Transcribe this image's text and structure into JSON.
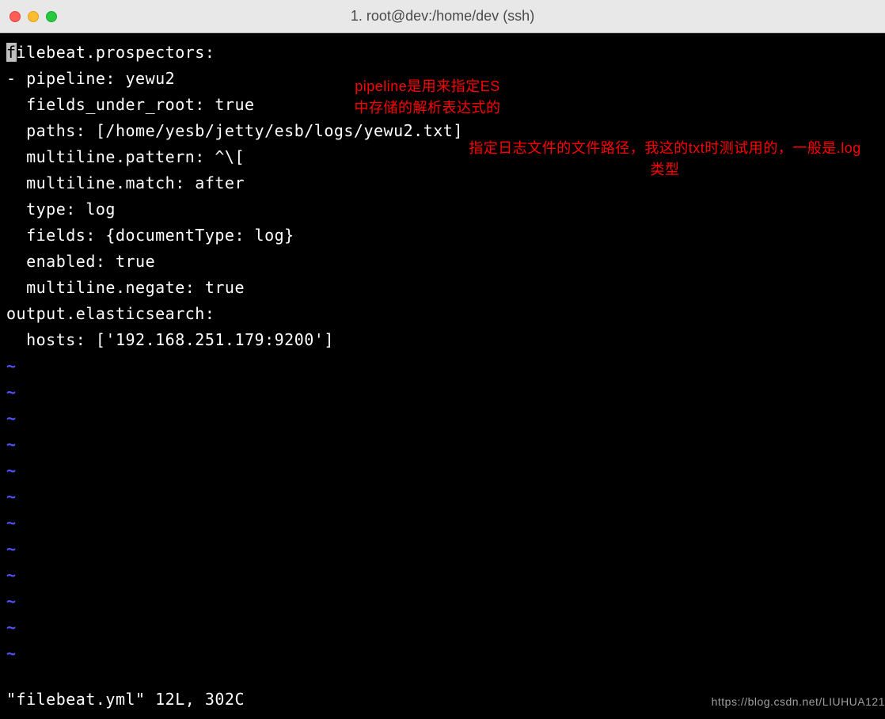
{
  "window": {
    "title": "1. root@dev:/home/dev (ssh)"
  },
  "editor": {
    "lines": {
      "l1_first": "f",
      "l1_rest": "ilebeat.prospectors:",
      "l2": "- pipeline: yewu2",
      "l3": "  fields_under_root: true",
      "l4": "  paths: [/home/yesb/jetty/esb/logs/yewu2.txt]",
      "l5": "  multiline.pattern: ^\\[",
      "l6": "  multiline.match: after",
      "l7": "  type: log",
      "l8": "  fields: {documentType: log}",
      "l9": "  enabled: true",
      "l10": "  multiline.negate: true",
      "l11": "output.elasticsearch:",
      "l12": "  hosts: ['192.168.251.179:9200']"
    },
    "tilde": "~",
    "status": "\"filebeat.yml\" 12L, 302C"
  },
  "annotations": {
    "a1": "pipeline是用来指定ES中存储的解析表达式的",
    "a2": "指定日志文件的文件路径，我这的txt时测试用的，一般是.log类型"
  },
  "watermark": "https://blog.csdn.net/LIUHUA121"
}
